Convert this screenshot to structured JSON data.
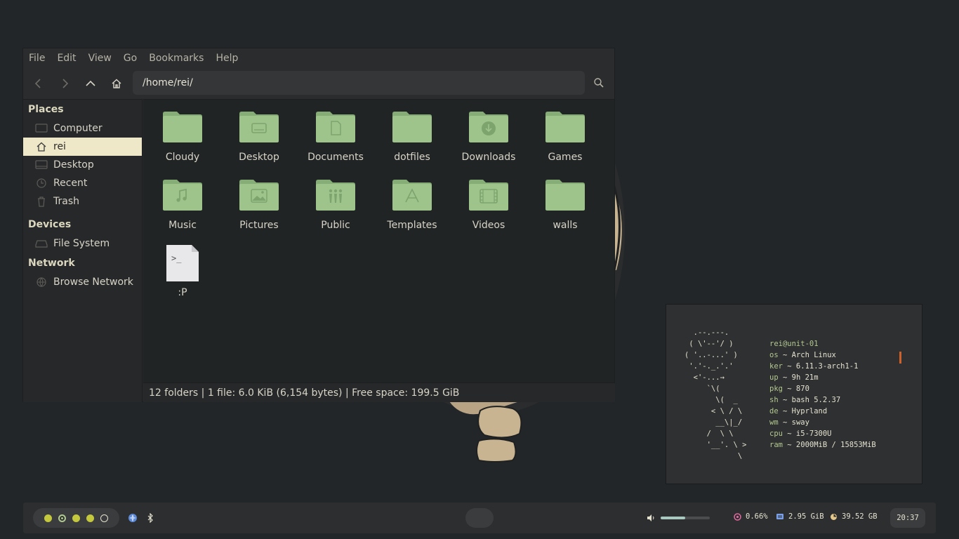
{
  "menubar": {
    "items": [
      "File",
      "Edit",
      "View",
      "Go",
      "Bookmarks",
      "Help"
    ]
  },
  "toolbar": {
    "path": "/home/rei/",
    "icons": [
      "back-icon",
      "forward-icon",
      "up-icon",
      "home-icon",
      "search-icon"
    ]
  },
  "sidebar": {
    "places_header": "Places",
    "places": [
      {
        "label": "Computer",
        "icon": "computer-icon"
      },
      {
        "label": "rei",
        "icon": "home-icon",
        "active": true
      },
      {
        "label": "Desktop",
        "icon": "desktop-icon"
      },
      {
        "label": "Recent",
        "icon": "clock-icon"
      },
      {
        "label": "Trash",
        "icon": "trash-icon"
      }
    ],
    "devices_header": "Devices",
    "devices": [
      {
        "label": "File System",
        "icon": "drive-icon"
      }
    ],
    "network_header": "Network",
    "network": [
      {
        "label": "Browse Network",
        "icon": "network-icon"
      }
    ]
  },
  "files": [
    {
      "name": "Cloudy",
      "type": "folder",
      "glyph": ""
    },
    {
      "name": "Desktop",
      "type": "folder",
      "glyph": "desktop"
    },
    {
      "name": "Documents",
      "type": "folder",
      "glyph": "document"
    },
    {
      "name": "dotfiles",
      "type": "folder",
      "glyph": ""
    },
    {
      "name": "Downloads",
      "type": "folder",
      "glyph": "download"
    },
    {
      "name": "Games",
      "type": "folder",
      "glyph": ""
    },
    {
      "name": "Music",
      "type": "folder",
      "glyph": "music"
    },
    {
      "name": "Pictures",
      "type": "folder",
      "glyph": "picture"
    },
    {
      "name": "Public",
      "type": "folder",
      "glyph": "people"
    },
    {
      "name": "Templates",
      "type": "folder",
      "glyph": "templates"
    },
    {
      "name": "Videos",
      "type": "folder",
      "glyph": "film"
    },
    {
      "name": "walls",
      "type": "folder",
      "glyph": ""
    },
    {
      "name": ":P",
      "type": "script",
      "glyph": ">_"
    }
  ],
  "statusbar": {
    "text": "12 folders  |  1 file: 6.0 KiB (6,154 bytes)  |  Free space: 199.5 GiB"
  },
  "terminal": {
    "ascii": "  .--.---.\n ( \\'--'/ )\n( '..-...' )\n '.'-._.'.'\n  <'-...→\n     `\\(\n       \\(  _\n      < \\ / \\\n       __\\|_/\n     /  \\ \\\n     '__'. \\ >\n            \\",
    "user_host": "rei@unit-01",
    "info": [
      {
        "key": "os",
        "value": "Arch Linux"
      },
      {
        "key": "ker",
        "value": "6.11.3-arch1-1"
      },
      {
        "key": "up",
        "value": "9h 21m"
      },
      {
        "key": "pkg",
        "value": "870"
      },
      {
        "key": "sh",
        "value": "bash 5.2.37"
      },
      {
        "key": "de",
        "value": "Hyprland"
      },
      {
        "key": "wm",
        "value": "sway"
      },
      {
        "key": "cpu",
        "value": "i5-7300U"
      },
      {
        "key": "ram",
        "value": "2000MiB / 15853MiB"
      }
    ]
  },
  "bar": {
    "workspaces": [
      {
        "color": "#c4c83c",
        "style": "filled"
      },
      {
        "color": "#b0c890",
        "style": "ring"
      },
      {
        "color": "#c4c83c",
        "style": "filled"
      },
      {
        "color": "#c4c83c",
        "style": "filled"
      },
      {
        "color": "#e6e2d0",
        "style": "hollow"
      }
    ],
    "volume_level": 0.5,
    "cpu": "0.66%",
    "memory": "2.95 GiB",
    "disk": "39.52 GB",
    "clock": "20:37"
  },
  "colors": {
    "accent": "#eee8c8",
    "folder": "#9ec48c",
    "folder_dark": "#86ad76"
  }
}
